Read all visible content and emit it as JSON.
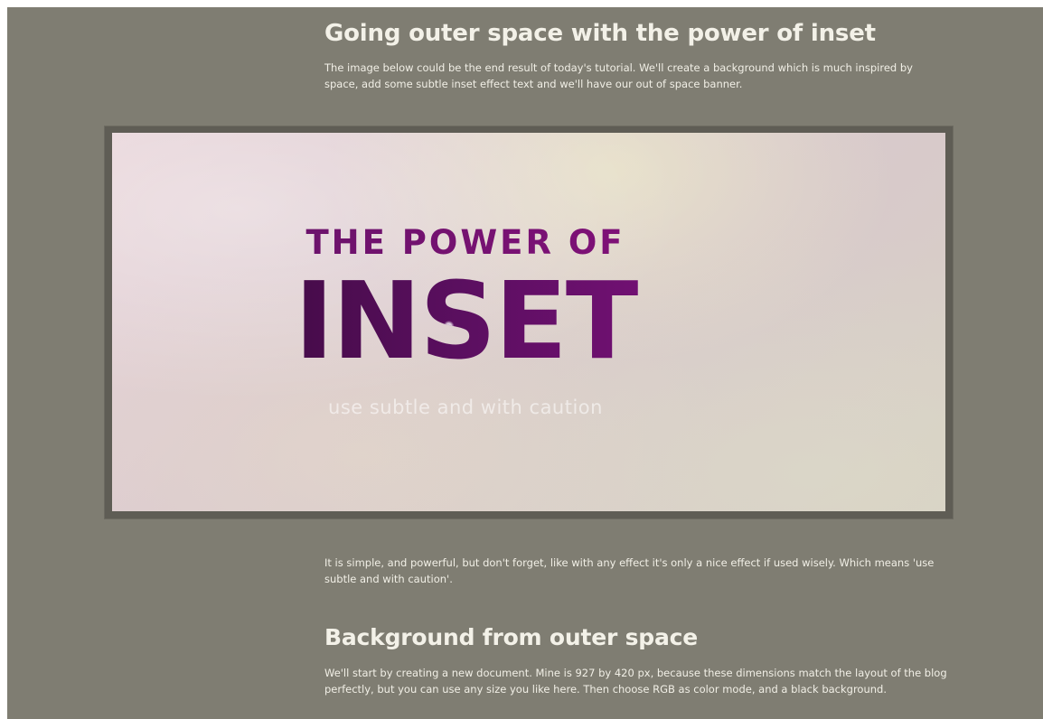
{
  "article": {
    "heading1": "Going outer space with the power of inset",
    "intro": "The image below could be the end result of today's tutorial. We'll create a background which is much inspired by space, add some subtle inset effect text and we'll have our out of space banner.",
    "banner": {
      "line1": "THE POWER OF",
      "line2": "INSET",
      "line3": "use subtle and with caution"
    },
    "paragraph2": "It is simple, and powerful, but don't forget, like with any effect it's only a nice effect if used wisely. Which means 'use subtle and with caution'.",
    "heading2": "Background from outer space",
    "paragraph3": "We'll start by creating a new document. Mine is 927 by 420 px, because these dimensions match the layout of the blog perfectly, but you can use any size you like here. Then choose RGB as color mode, and a black background."
  },
  "colors": {
    "page_background": "#7f7d72",
    "frame": "#5f5d55",
    "text": "#f1efe6",
    "inset_purple": "#7a1174"
  }
}
